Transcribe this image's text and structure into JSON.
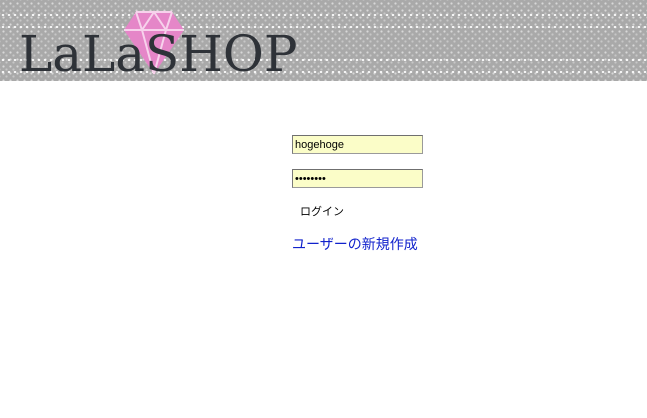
{
  "header": {
    "logo_text": "LaLaSHOP",
    "brand_text_color": "#2e3238",
    "diamond_color": "#e586c8",
    "background_color": "#a9a9a9"
  },
  "login": {
    "username_value": "hogehoge",
    "password_value": "••••••••",
    "field_background": "#fbfdc8",
    "login_button_label": "ログイン",
    "signup_link_label": "ユーザーの新規作成",
    "link_color": "#1122cc"
  }
}
